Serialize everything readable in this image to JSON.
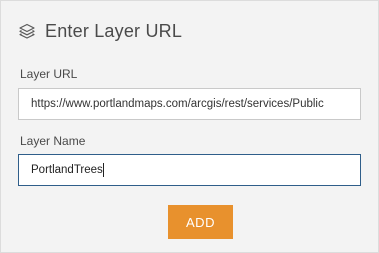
{
  "panel": {
    "title": "Enter Layer URL",
    "icon": "layers-icon"
  },
  "layer_url": {
    "label": "Layer URL",
    "value": "https://www.portlandmaps.com/arcgis/rest/services/Public"
  },
  "layer_name": {
    "label": "Layer Name",
    "value": "PortlandTrees"
  },
  "add_button": {
    "label": "ADD",
    "color": "#e8912d"
  },
  "colors": {
    "panel_background": "#f3f3f3",
    "focused_border": "#2f5e8a"
  }
}
